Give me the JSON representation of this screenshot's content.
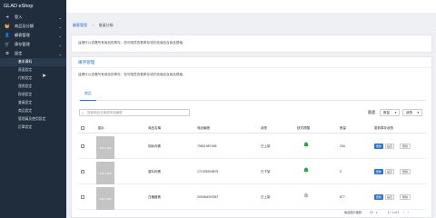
{
  "app": {
    "brand": "GLAD eShop"
  },
  "sidebar": {
    "items": [
      {
        "icon": "login-icon",
        "glyph": "➜",
        "label": "登入",
        "chevron": true
      },
      {
        "icon": "basket-icon",
        "glyph": "🧺",
        "label": "商品及分類",
        "chevron": true
      },
      {
        "icon": "user-icon",
        "glyph": "👤",
        "label": "顧客管理",
        "chevron": true
      },
      {
        "icon": "cart-icon",
        "glyph": "🛒",
        "label": "庫存管理",
        "chevron": true
      },
      {
        "icon": "gear-icon",
        "glyph": "⚙",
        "label": "設定",
        "chevron": true
      }
    ],
    "sub_items": [
      "基本資料",
      "頁面設定",
      "付款設定",
      "運費設定",
      "稅項設定",
      "會員設定",
      "商品設定",
      "管理員及使用設定",
      "訂單設定"
    ]
  },
  "breadcrumb": {
    "first": "顧客管理",
    "separator": ">",
    "second": "會員分級"
  },
  "card1": {
    "description": "這裡可以查看所有商品的庫存，您可隨意查看庫存或於該商品及商品規格。"
  },
  "card2": {
    "title": "庫存管理",
    "description": "這裡可以查看所有商品的庫存，您可隨意查看庫存或於該商品及商品規格。",
    "tab": "商品",
    "search_placeholder": "搜尋商品名稱或商品編號",
    "filter_label": "篩選",
    "dropdown1": "數量",
    "dropdown2": "狀態"
  },
  "table": {
    "headers": [
      "圖片",
      "商品名稱",
      "商品編號",
      "狀態",
      "缺貨提醒",
      "數量",
      "更新庫存狀態"
    ],
    "image_placeholder": "200 x 200",
    "rows": [
      {
        "name": "卸妝肉蛋",
        "code": "79821987498",
        "status": "已上架",
        "bell_color": "#2e9e4f",
        "qty": "234",
        "qty_color": "#333333"
      },
      {
        "name": "香料肉蛋",
        "code": "171935309875",
        "status": "已下架",
        "bell_color": "#2e9e4f",
        "qty": "8",
        "qty_color": "#d9342b"
      },
      {
        "name": "白糖雞蛋",
        "code": "209384097687",
        "status": "已上架",
        "bell_color": "#b8bcc2",
        "qty": "877",
        "qty_color": "#333333"
      }
    ],
    "btn_edit": "更新",
    "btn_status": "設定",
    "btn_delete": "刪除"
  },
  "footer": {
    "per_page_label": "每頁顯示筆數",
    "per_page": "10",
    "page_info": "1 / 1 of 3"
  }
}
